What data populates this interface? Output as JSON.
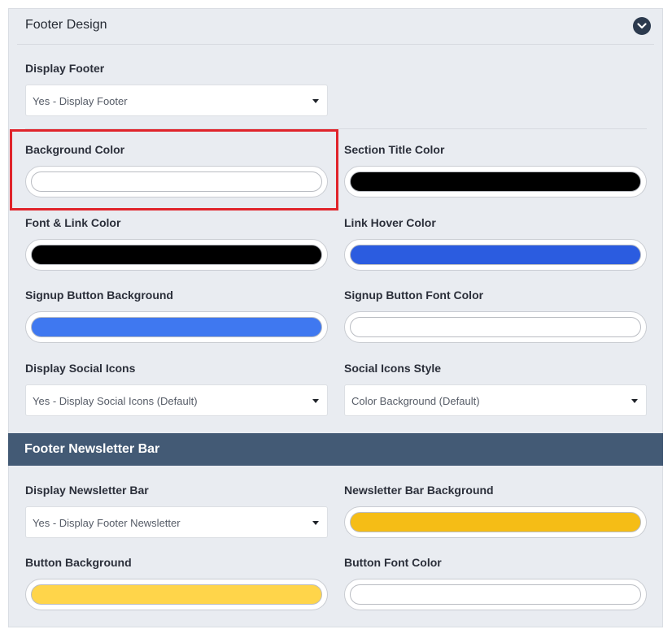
{
  "footer_design": {
    "title": "Footer Design",
    "collapse_icon": "chevron-down-icon",
    "display_footer": {
      "label": "Display Footer",
      "value": "Yes - Display Footer"
    },
    "background_color": {
      "label": "Background Color",
      "color": "#ffffff"
    },
    "section_title_color": {
      "label": "Section Title Color",
      "color": "#000000"
    },
    "font_link_color": {
      "label": "Font & Link Color",
      "color": "#000000"
    },
    "link_hover_color": {
      "label": "Link Hover Color",
      "color": "#2b5ce0"
    },
    "signup_button_background": {
      "label": "Signup Button Background",
      "color": "#3f78f0"
    },
    "signup_button_font_color": {
      "label": "Signup Button Font Color",
      "color": "#ffffff"
    },
    "display_social_icons": {
      "label": "Display Social Icons",
      "value": "Yes - Display Social Icons (Default)"
    },
    "social_icons_style": {
      "label": "Social Icons Style",
      "value": "Color Background (Default)"
    }
  },
  "footer_newsletter_bar": {
    "title": "Footer Newsletter Bar",
    "display_newsletter_bar": {
      "label": "Display Newsletter Bar",
      "value": "Yes - Display Footer Newsletter"
    },
    "newsletter_bar_background": {
      "label": "Newsletter Bar Background",
      "color": "#f5bd16"
    },
    "button_background": {
      "label": "Button Background",
      "color": "#ffd54a"
    },
    "button_font_color": {
      "label": "Button Font Color",
      "color": "#ffffff"
    }
  },
  "colors": {
    "panel_background": "#e9ecf1",
    "section_bar": "#435a75",
    "highlight_border": "#e0242b"
  }
}
